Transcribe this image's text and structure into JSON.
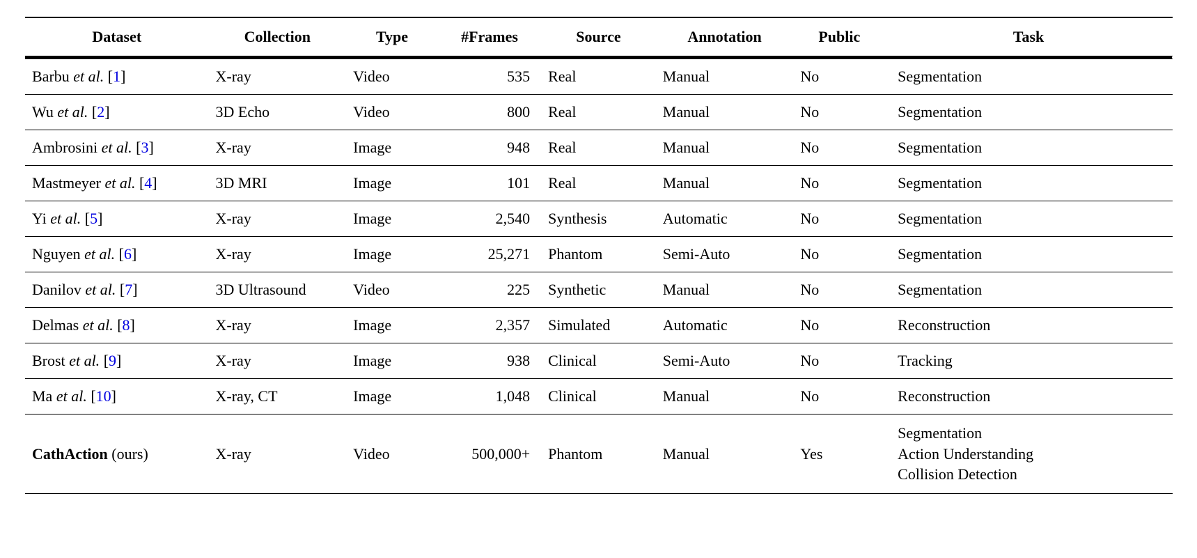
{
  "chart_data": {
    "type": "table",
    "columns": [
      "Dataset",
      "Collection",
      "Type",
      "#Frames",
      "Source",
      "Annotation",
      "Public",
      "Task"
    ],
    "rows": [
      {
        "dataset_author": "Barbu",
        "etal": "et al.",
        "ref": "1",
        "collection": "X-ray",
        "type": "Video",
        "frames": "535",
        "source": "Real",
        "annotation": "Manual",
        "public": "No",
        "task": "Segmentation"
      },
      {
        "dataset_author": "Wu",
        "etal": "et al.",
        "ref": "2",
        "collection": "3D Echo",
        "type": "Video",
        "frames": "800",
        "source": "Real",
        "annotation": "Manual",
        "public": "No",
        "task": "Segmentation"
      },
      {
        "dataset_author": "Ambrosini",
        "etal": "et al.",
        "ref": "3",
        "collection": "X-ray",
        "type": "Image",
        "frames": "948",
        "source": "Real",
        "annotation": "Manual",
        "public": "No",
        "task": "Segmentation"
      },
      {
        "dataset_author": "Mastmeyer",
        "etal": "et al.",
        "ref": "4",
        "collection": "3D MRI",
        "type": "Image",
        "frames": "101",
        "source": "Real",
        "annotation": "Manual",
        "public": "No",
        "task": "Segmentation"
      },
      {
        "dataset_author": "Yi",
        "etal": "et al.",
        "ref": "5",
        "collection": "X-ray",
        "type": "Image",
        "frames": "2,540",
        "source": "Synthesis",
        "annotation": "Automatic",
        "public": "No",
        "task": "Segmentation"
      },
      {
        "dataset_author": "Nguyen",
        "etal": "et al.",
        "ref": "6",
        "collection": "X-ray",
        "type": "Image",
        "frames": "25,271",
        "source": "Phantom",
        "annotation": "Semi-Auto",
        "public": "No",
        "task": "Segmentation"
      },
      {
        "dataset_author": "Danilov",
        "etal": "et al.",
        "ref": "7",
        "collection": "3D Ultrasound",
        "type": "Video",
        "frames": "225",
        "source": "Synthetic",
        "annotation": "Manual",
        "public": "No",
        "task": "Segmentation"
      },
      {
        "dataset_author": "Delmas",
        "etal": "et al.",
        "ref": "8",
        "collection": "X-ray",
        "type": "Image",
        "frames": "2,357",
        "source": "Simulated",
        "annotation": "Automatic",
        "public": "No",
        "task": "Reconstruction"
      },
      {
        "dataset_author": "Brost",
        "etal": "et al.",
        "ref": "9",
        "collection": "X-ray",
        "type": "Image",
        "frames": "938",
        "source": "Clinical",
        "annotation": "Semi-Auto",
        "public": "No",
        "task": "Tracking"
      },
      {
        "dataset_author": "Ma",
        "etal": "et al.",
        "ref": "10",
        "collection": "X-ray, CT",
        "type": "Image",
        "frames": "1,048",
        "source": "Clinical",
        "annotation": "Manual",
        "public": "No",
        "task": "Reconstruction"
      }
    ],
    "ours_row": {
      "dataset_bold": "CathAction",
      "dataset_suffix": " (ours)",
      "collection": "X-ray",
      "type": "Video",
      "frames": "500,000+",
      "source": "Phantom",
      "annotation": "Manual",
      "public": "Yes",
      "task_line1": "Segmentation",
      "task_line2": "Action Understanding",
      "task_line3": "Collision Detection"
    }
  },
  "headers": {
    "dataset": "Dataset",
    "collection": "Collection",
    "type": "Type",
    "frames": "#Frames",
    "source": "Source",
    "annotation": "Annotation",
    "public": "Public",
    "task": "Task"
  }
}
